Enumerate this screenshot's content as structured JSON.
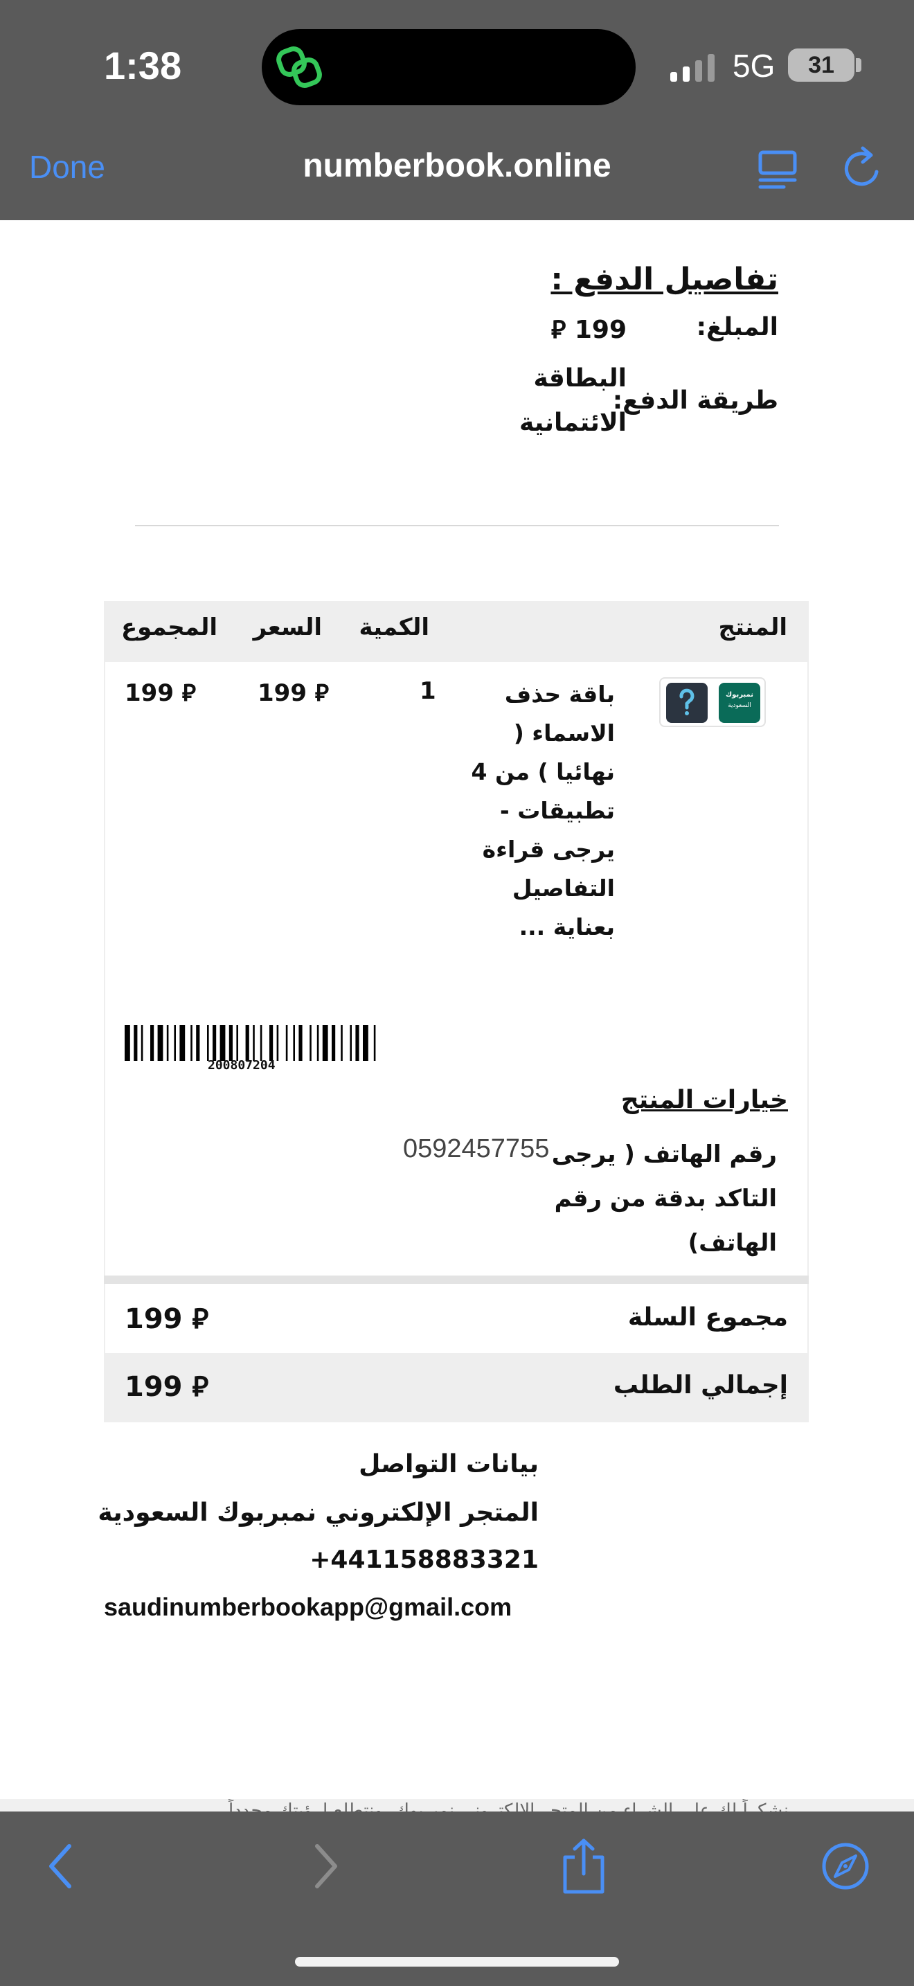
{
  "status_bar": {
    "time": "1:38",
    "network": "5G",
    "battery": "31"
  },
  "browser": {
    "done_label": "Done",
    "url": "numberbook.online"
  },
  "payment": {
    "title": "تفاصيل الدفع :",
    "amount_label": "المبلغ:",
    "amount_value": "199 ⃁",
    "method_label": "طريقة الدفع:",
    "method_value_line1": "البطاقة",
    "method_value_line2": "الائتمانية"
  },
  "table": {
    "headers": {
      "product": "المنتج",
      "quantity": "الكمية",
      "price": "السعر",
      "total": "المجموع"
    },
    "row": {
      "product_name": "باقة حذف الاسماء ( نهائيا ) من 4 تطبيقات - يرجى قراءة التفاصيل بعناية ...",
      "quantity": "1",
      "price": "199 ⃁",
      "total": "199 ⃁",
      "image_label_line1": "نمبربوك",
      "image_label_line2": "السعودية"
    },
    "barcode_number": "200807204",
    "options_title": "خيارات المنتج",
    "option_label": "رقم الهاتف ( يرجى التاكد بدقة من رقم الهاتف)",
    "option_value": "0592457755",
    "cart_total_label": "مجموع السلة",
    "cart_total_value": "199 ⃁",
    "order_total_label": "إجمالي الطلب",
    "order_total_value": "199 ⃁"
  },
  "contact": {
    "title": "بيانات التواصل",
    "store_name": "المتجر الإلكتروني نمبربوك السعودية",
    "phone": "+441158883321",
    "email": "saudinumberbookapp@gmail.com"
  },
  "footer_snippet": "نشكراً لك على الشراء من المتجر الإلكتروني نمبربوك، ونتطلع لرؤيتك مجدداً",
  "colors": {
    "accent": "#4a8ff5",
    "chrome": "#5a5a5a",
    "island_icon": "#34c759"
  }
}
